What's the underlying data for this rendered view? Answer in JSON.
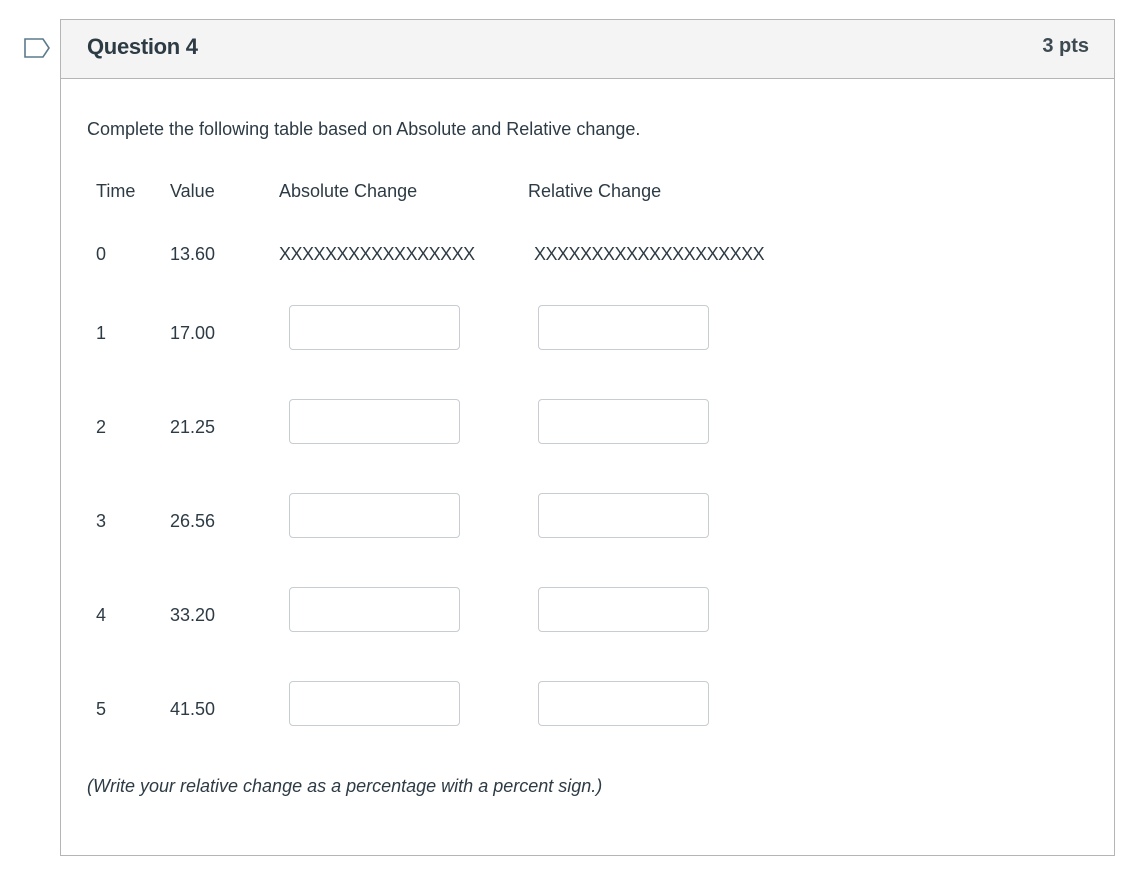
{
  "question": {
    "title": "Question 4",
    "points": "3 pts",
    "prompt": "Complete the following table based on Absolute and Relative change.",
    "note": "(Write your relative change as a percentage with a percent sign.)"
  },
  "table": {
    "headers": [
      "Time",
      "Value",
      "Absolute Change",
      "Relative Change"
    ],
    "rows": [
      {
        "time": "0",
        "value": "13.60",
        "absolute": "XXXXXXXXXXXXXXXXX",
        "relative": "XXXXXXXXXXXXXXXXXXXX"
      },
      {
        "time": "1",
        "value": "17.00",
        "absolute": "",
        "relative": ""
      },
      {
        "time": "2",
        "value": "21.25",
        "absolute": "",
        "relative": ""
      },
      {
        "time": "3",
        "value": "26.56",
        "absolute": "",
        "relative": ""
      },
      {
        "time": "4",
        "value": "33.20",
        "absolute": "",
        "relative": ""
      },
      {
        "time": "5",
        "value": "41.50",
        "absolute": "",
        "relative": ""
      }
    ]
  },
  "colors": {
    "flag": "#5b7a8c",
    "header_bg": "#f4f4f4",
    "border": "#b5b5b5",
    "text": "#2d3b45"
  }
}
